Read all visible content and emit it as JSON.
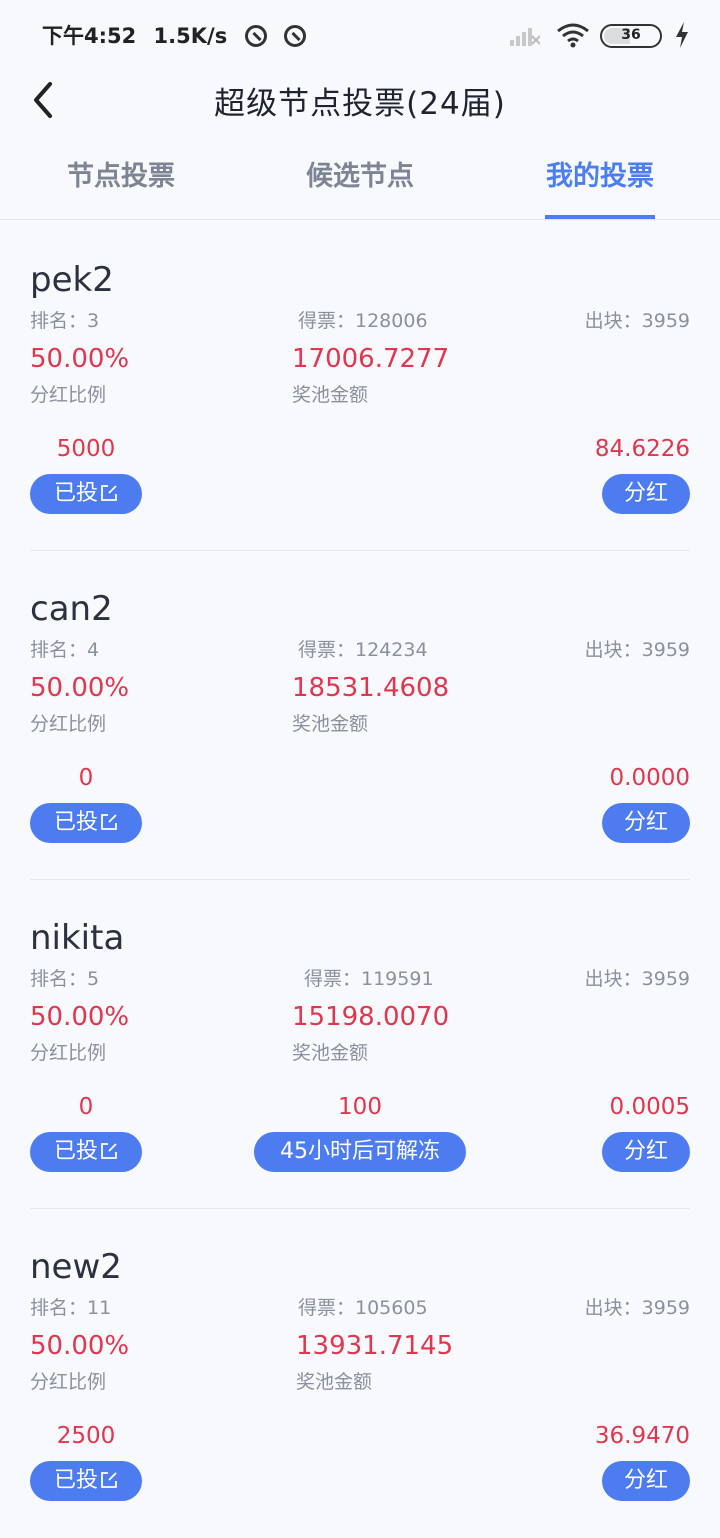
{
  "status_bar": {
    "time": "下午4:52",
    "speed": "1.5K/s",
    "battery": "36"
  },
  "nav": {
    "title": "超级节点投票(24届)"
  },
  "tabs": [
    {
      "label": "节点投票",
      "active": false
    },
    {
      "label": "候选节点",
      "active": false
    },
    {
      "label": "我的投票",
      "active": true
    }
  ],
  "labels": {
    "rank_prefix": "排名：",
    "votes_prefix": "得票：",
    "blocks_prefix": "出块：",
    "ratio_label": "分红比例",
    "pool_label": "奖池金额",
    "voted_button": "已投",
    "bonus_button": "分红"
  },
  "nodes": [
    {
      "name": "pek2",
      "rank": "排名：3",
      "votes": "得票：128006",
      "blocks": "出块：3959",
      "ratio": "50.00%",
      "pool": "17006.7277",
      "my_votes": "5000",
      "bonus": "84.6226"
    },
    {
      "name": "can2",
      "rank": "排名：4",
      "votes": "得票：124234",
      "blocks": "出块：3959",
      "ratio": "50.00%",
      "pool": "18531.4608",
      "my_votes": "0",
      "bonus": "0.0000"
    },
    {
      "name": "nikita",
      "rank": "排名：5",
      "votes": "得票：119591",
      "blocks": "出块：3959",
      "ratio": "50.00%",
      "pool": "15198.0070",
      "my_votes": "0",
      "frozen_amount": "100",
      "unfreeze_label": "45小时后可解冻",
      "bonus": "0.0005"
    },
    {
      "name": "new2",
      "rank": "排名：11",
      "votes": "得票：105605",
      "blocks": "出块：3959",
      "ratio": "50.00%",
      "pool": "13931.7145",
      "my_votes": "2500",
      "bonus": "36.9470"
    }
  ]
}
